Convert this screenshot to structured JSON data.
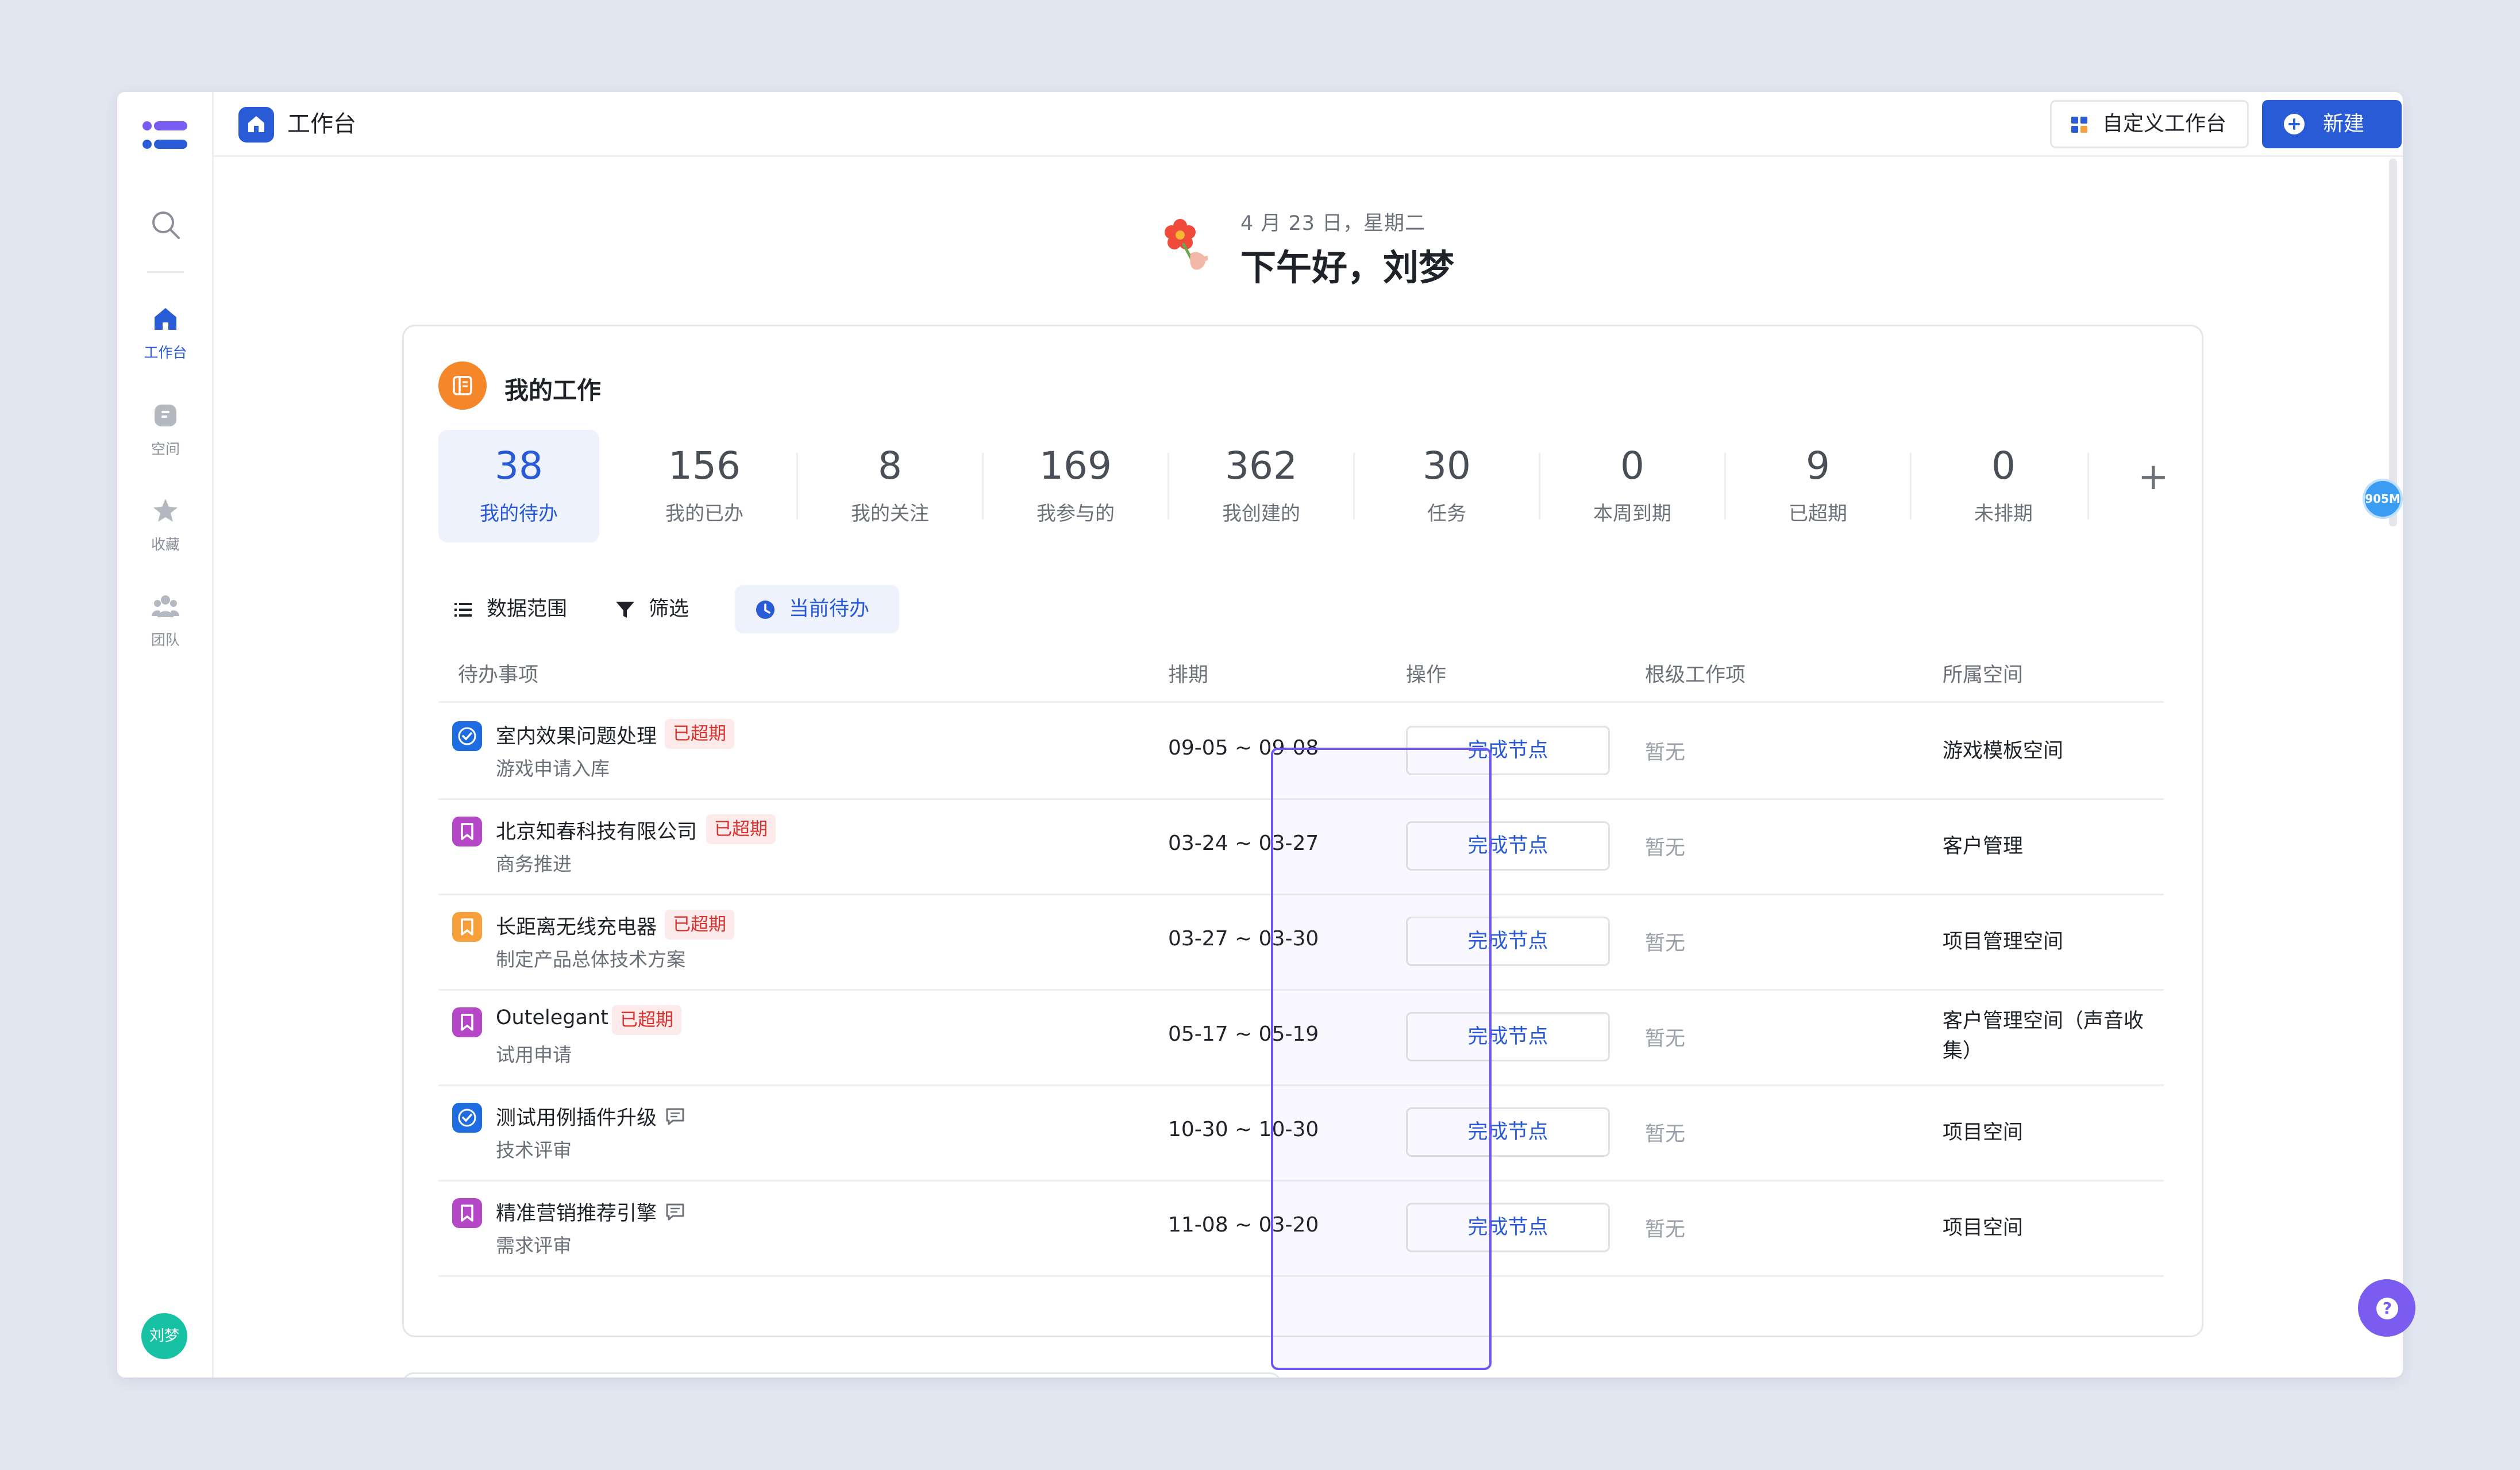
{
  "sidebar": {
    "items": [
      {
        "label": "工作台",
        "icon": "home-icon",
        "active": true
      },
      {
        "label": "空间",
        "icon": "space-icon",
        "active": false
      },
      {
        "label": "收藏",
        "icon": "star-icon",
        "active": false
      },
      {
        "label": "团队",
        "icon": "team-icon",
        "active": false
      }
    ],
    "avatar_text": "刘梦"
  },
  "topbar": {
    "title": "工作台",
    "customize_label": "自定义工作台",
    "new_label": "新建"
  },
  "greeting": {
    "date": "4 月 23 日，星期二",
    "text": "下午好，刘梦"
  },
  "card": {
    "title": "我的工作",
    "stats": [
      {
        "value": "38",
        "label": "我的待办",
        "active": true
      },
      {
        "value": "156",
        "label": "我的已办"
      },
      {
        "value": "8",
        "label": "我的关注"
      },
      {
        "value": "169",
        "label": "我参与的"
      },
      {
        "value": "362",
        "label": "我创建的"
      },
      {
        "value": "30",
        "label": "任务"
      },
      {
        "value": "0",
        "label": "本周到期"
      },
      {
        "value": "9",
        "label": "已超期"
      },
      {
        "value": "0",
        "label": "未排期"
      }
    ],
    "add_label": "+",
    "filters": {
      "scope": "数据范围",
      "filter": "筛选",
      "current": "当前待办"
    },
    "columns": {
      "item": "待办事项",
      "schedule": "排期",
      "action": "操作",
      "parent": "根级工作项",
      "space": "所属空间"
    },
    "rows": [
      {
        "icon": "check-circle-icon",
        "icon_color": "#1f6ce0",
        "title": "室内效果问题处理",
        "badge": "已超期",
        "subtitle": "游戏申请入库",
        "schedule": "09-05 ~ 09-08",
        "action": "完成节点",
        "parent": "暂无",
        "space": "游戏模板空间"
      },
      {
        "icon": "bookmark-icon",
        "icon_color": "#b548c6",
        "title": "北京知春科技有限公司",
        "badge": "已超期",
        "subtitle": "商务推进",
        "schedule": "03-24 ~ 03-27",
        "action": "完成节点",
        "parent": "暂无",
        "space": "客户管理"
      },
      {
        "icon": "bookmark-icon",
        "icon_color": "#f5a03a",
        "title": "长距离无线充电器",
        "badge": "已超期",
        "subtitle": "制定产品总体技术方案",
        "schedule": "03-27 ~ 03-30",
        "action": "完成节点",
        "parent": "暂无",
        "space": "项目管理空间"
      },
      {
        "icon": "bookmark-icon",
        "icon_color": "#b548c6",
        "title": "Outelegant",
        "badge": "已超期",
        "subtitle": "试用申请",
        "schedule": "05-17 ~ 05-19",
        "action": "完成节点",
        "parent": "暂无",
        "space": "客户管理空间（声音收集）"
      },
      {
        "icon": "check-circle-icon",
        "icon_color": "#1f6ce0",
        "title": "测试用例插件升级",
        "badge": "",
        "subtitle": "技术评审",
        "schedule": "10-30 ~ 10-30",
        "action": "完成节点",
        "parent": "暂无",
        "space": "项目空间"
      },
      {
        "icon": "bookmark-icon",
        "icon_color": "#b548c6",
        "title": "精准营销推荐引擎",
        "badge": "",
        "subtitle": "需求评审",
        "schedule": "11-08 ~ 03-20",
        "action": "完成节点",
        "parent": "暂无",
        "space": "项目空间"
      }
    ]
  },
  "floaters": {
    "memory_badge": "905M",
    "help": "?"
  },
  "colors": {
    "accent": "#2a5bd7",
    "overdue": "#d7332e",
    "highlight": "#6d57f0"
  }
}
